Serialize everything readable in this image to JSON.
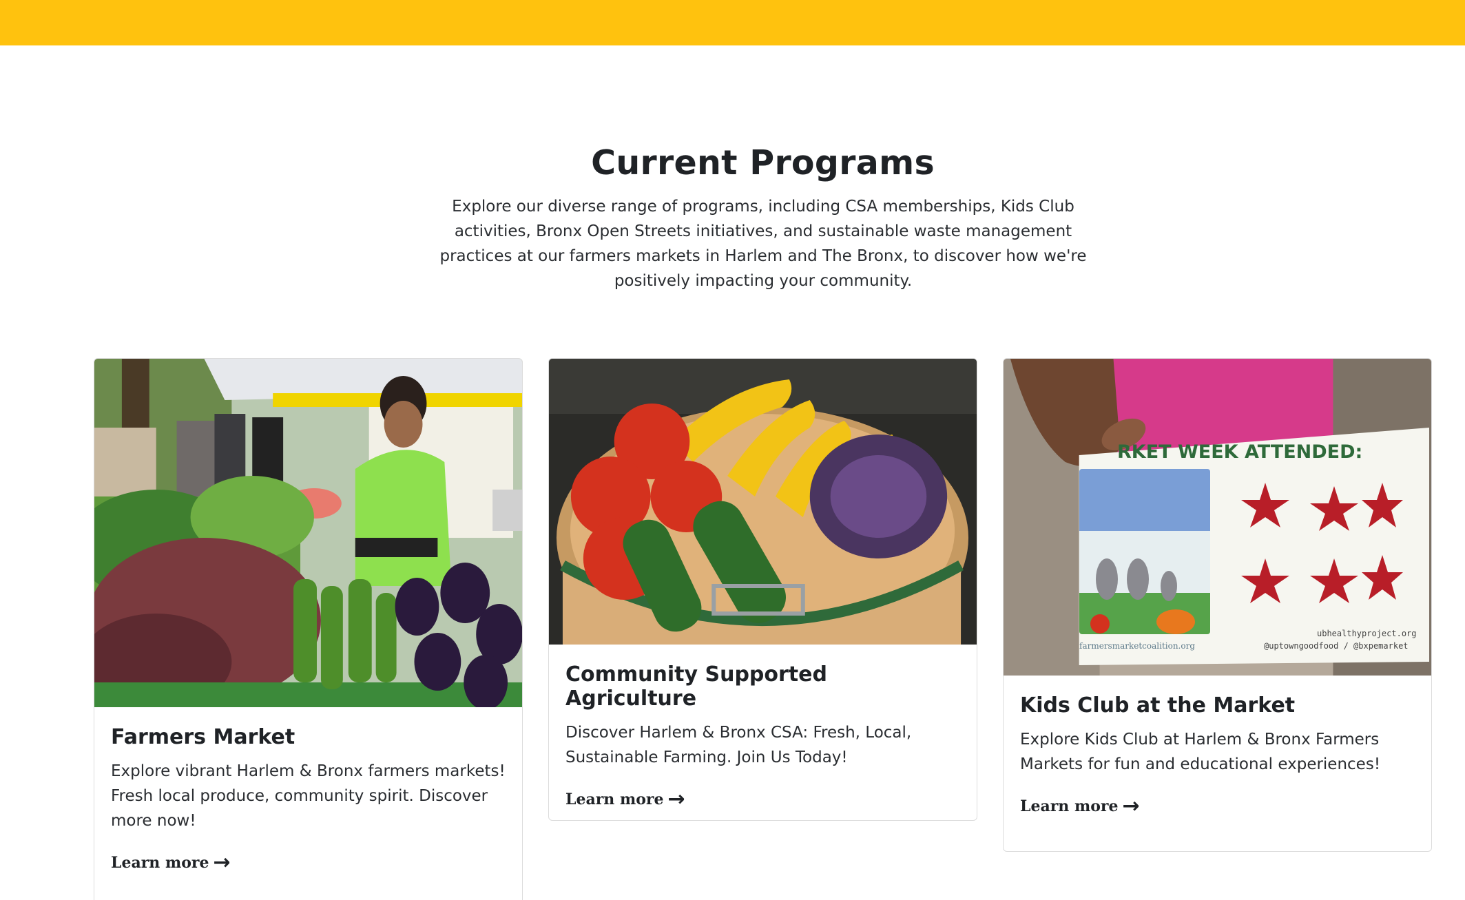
{
  "section": {
    "title": "Current Programs",
    "description": "Explore our diverse range of programs, including CSA memberships, Kids Club activities, Bronx Open Streets initiatives, and sustainable waste management practices at our farmers markets in Harlem and The Bronx, to discover how we're positively impacting your community."
  },
  "colors": {
    "top_bar": "#ffc20e",
    "text": "#1f2226"
  },
  "cards": [
    {
      "title": "Farmers Market",
      "text": "Explore vibrant Harlem & Bronx farmers markets! Fresh local produce, community spirit. Discover more now!",
      "link_label": "Learn more",
      "arrow_icon": "→"
    },
    {
      "title": "Community Supported Agriculture",
      "text": "Discover Harlem & Bronx CSA: Fresh, Local, Sustainable Farming. Join Us Today!",
      "link_label": "Learn more",
      "arrow_icon": "→"
    },
    {
      "title": "Kids Club at the Market",
      "text": "Explore Kids Club at Harlem & Bronx Farmers Markets for fun and educational experiences!",
      "link_label": "Learn more",
      "arrow_icon": "→",
      "image_text": {
        "banner": "RKET WEEK ATTENDED:",
        "site_left": "farmersmarketcoalition.org",
        "site_right": "ubhealthyproject.org",
        "handles": "@uptowngoodfood / @bxpemarket"
      }
    }
  ]
}
